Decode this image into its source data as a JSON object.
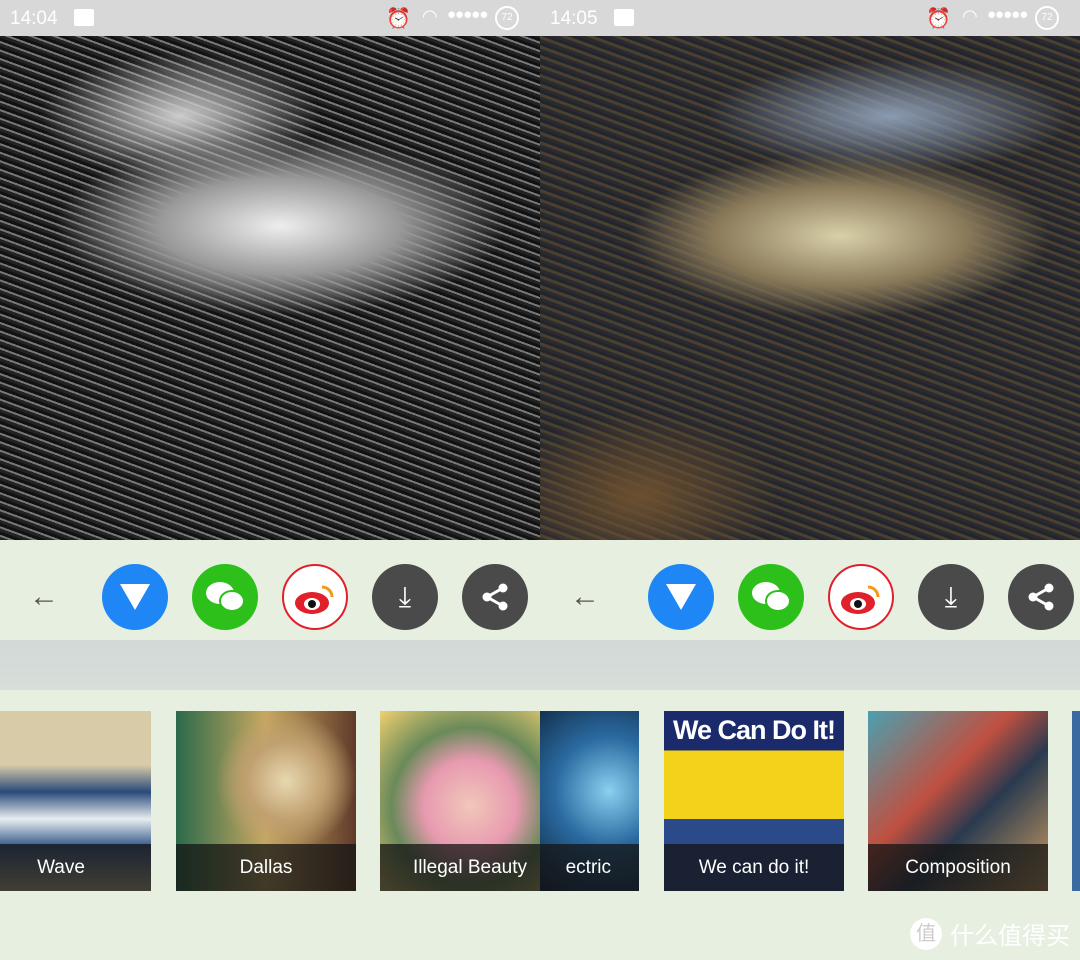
{
  "panels": [
    {
      "time": "14:04",
      "battery": "72",
      "cards": [
        {
          "label": "Wave"
        },
        {
          "label": "Dallas"
        },
        {
          "label": "Illegal Beauty"
        }
      ]
    },
    {
      "time": "14:05",
      "battery": "72",
      "cards": [
        {
          "label": "ectric"
        },
        {
          "label": "We can do it!"
        },
        {
          "label": "Composition"
        }
      ],
      "poster_text": "We Can Do It!"
    }
  ],
  "toolbar": {
    "back": "←",
    "download": "⤓",
    "share": "share-icon"
  },
  "colors": {
    "blue": "#1f87f5",
    "wechat": "#2dbf1a",
    "weibo": "#e0202a",
    "dark": "#4a4a4a"
  },
  "watermark": {
    "badge": "值",
    "text": "什么值得买"
  }
}
